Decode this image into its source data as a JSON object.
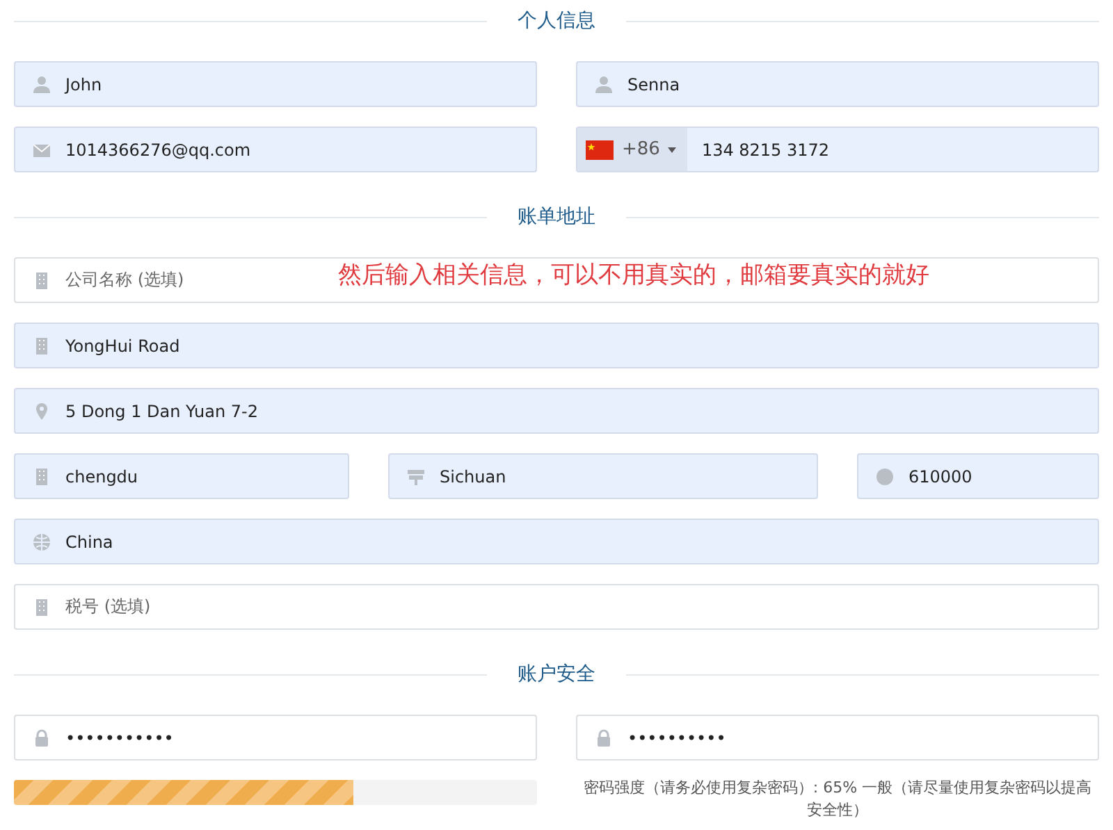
{
  "sections": [
    {
      "title": "个人信息",
      "rows": [
        [
          {
            "kind": "name",
            "value": "John",
            "autofilled": true
          },
          {
            "kind": "name",
            "value": "Senna",
            "autofilled": true
          }
        ],
        [
          {
            "kind": "email",
            "value": "1014366276@qq.com",
            "autofilled": true
          },
          {
            "kind": "phone",
            "country_code": "+86",
            "value": "134 8215 3172",
            "autofilled": true
          }
        ]
      ]
    },
    {
      "title": "账单地址",
      "rows": [
        [
          {
            "kind": "company",
            "placeholder": "公司名称 (选填)",
            "autofilled": false
          }
        ],
        [
          {
            "kind": "street",
            "value": "YongHui Road",
            "autofilled": true
          }
        ],
        [
          {
            "kind": "address",
            "value": "5 Dong 1 Dan Yuan 7-2",
            "autofilled": true
          }
        ],
        [
          {
            "kind": "city",
            "value": "chengdu",
            "autofilled": true
          },
          {
            "kind": "province",
            "value": "Sichuan",
            "autofilled": true
          },
          {
            "kind": "postcode",
            "value": "610000",
            "autofilled": true
          }
        ],
        [
          {
            "kind": "country",
            "value": "China",
            "autofilled": true
          }
        ],
        [
          {
            "kind": "tax",
            "placeholder": "税号 (选填)",
            "autofilled": false
          }
        ]
      ]
    },
    {
      "title": "账户安全",
      "rows": [
        [
          {
            "kind": "password",
            "value": "•••••••••••",
            "autofilled": false
          },
          {
            "kind": "password",
            "value": "••••••••••",
            "autofilled": false
          }
        ]
      ]
    }
  ],
  "annotation": {
    "text": "然后输入相关信息，可以不用真实的，邮箱要真实的就好"
  },
  "password_strength": {
    "level": 0.65,
    "text": "密码强度（请务必使用复杂密码）: 65% 一般（请尽量使用复杂密码以提高安全性）"
  }
}
